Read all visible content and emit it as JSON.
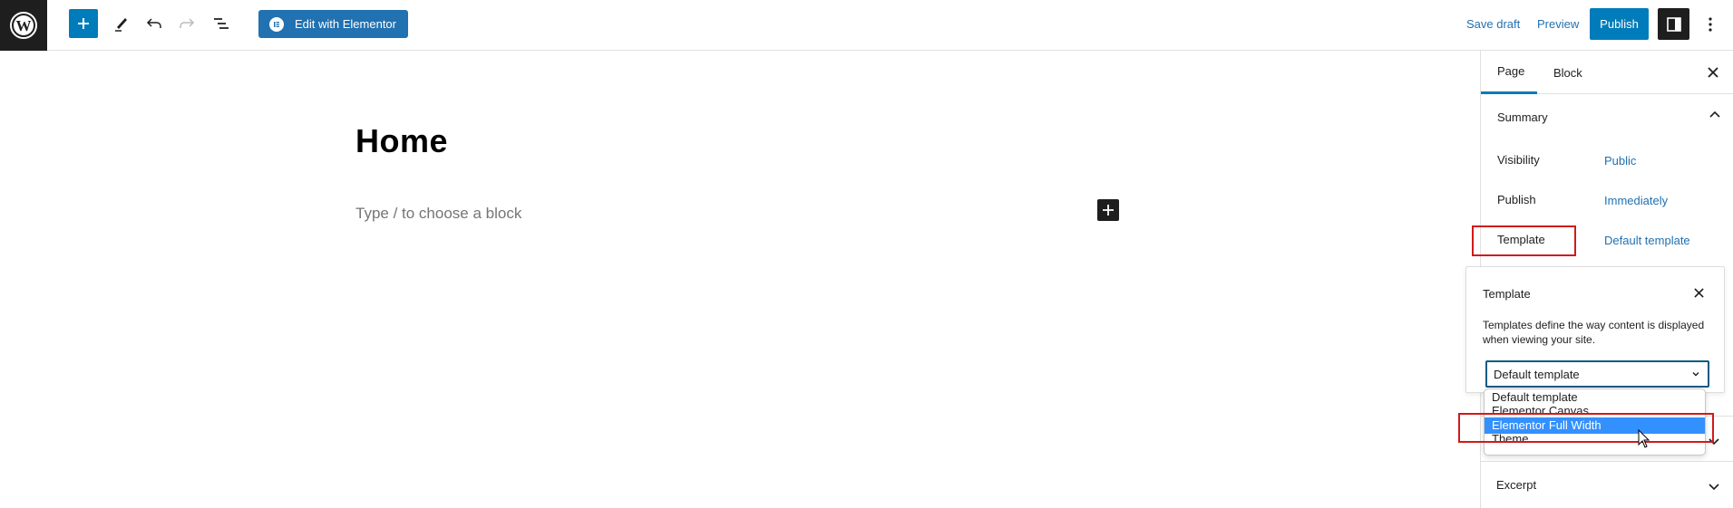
{
  "toolbar": {
    "logo_icon": "wordpress-logo",
    "inserter_icon": "plus-icon",
    "tools_icon": "pencil-icon",
    "undo_icon": "undo-icon",
    "redo_icon": "redo-icon",
    "list_view_icon": "list-view-icon",
    "elementor_label": "Edit with Elementor",
    "save_draft_label": "Save draft",
    "preview_label": "Preview",
    "publish_label": "Publish",
    "settings_icon": "sidebar-toggle-icon",
    "more_icon": "more-vertical-icon",
    "accent_color": "#007cba"
  },
  "editor": {
    "title": "Home",
    "block_placeholder": "Type / to choose a block"
  },
  "sidebar": {
    "tabs": [
      {
        "label": "Page",
        "active": true
      },
      {
        "label": "Block",
        "active": false
      }
    ],
    "summary": {
      "heading": "Summary",
      "rows": [
        {
          "label": "Visibility",
          "value": "Public"
        },
        {
          "label": "Publish",
          "value": "Immediately"
        },
        {
          "label": "Template",
          "value": "Default template"
        }
      ]
    },
    "template_popover": {
      "title": "Template",
      "help": "Templates define the way content is displayed when viewing your site.",
      "select_value": "Default template",
      "options": [
        "Default template",
        "Elementor Canvas",
        "Elementor Full Width",
        "Theme"
      ],
      "highlighted_option": "Elementor Full Width"
    },
    "excerpt_label": "Excerpt"
  },
  "highlight_color": "#d11a1a"
}
